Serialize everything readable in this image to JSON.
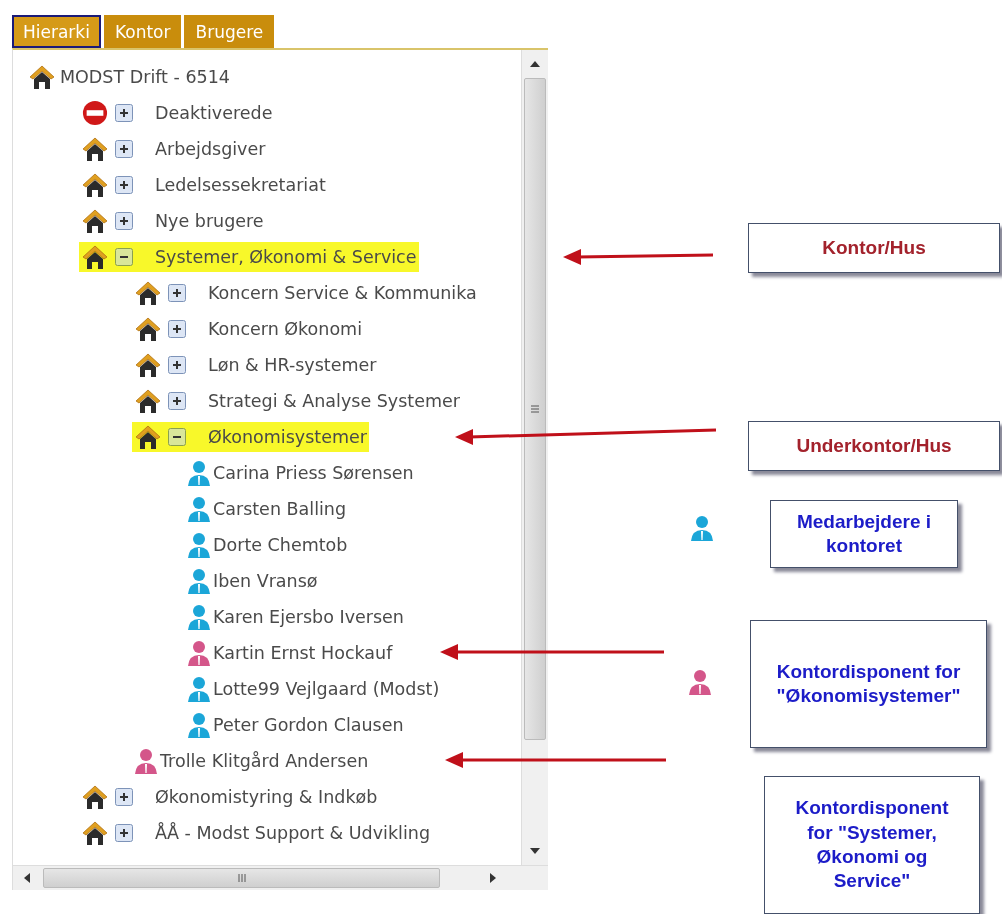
{
  "tabs": [
    {
      "label": "Hierarki",
      "selected": true
    },
    {
      "label": "Kontor",
      "selected": false
    },
    {
      "label": "Brugere",
      "selected": false
    }
  ],
  "tree": {
    "label": "MODST Drift - 6514",
    "kind": "office",
    "highlighted": false,
    "children": [
      {
        "label": "Deaktiverede",
        "kind": "deactivated",
        "expanded": false,
        "highlighted": false
      },
      {
        "label": "Arbejdsgiver",
        "kind": "office",
        "expanded": false,
        "highlighted": false
      },
      {
        "label": "Ledelsessekretariat",
        "kind": "office",
        "expanded": false,
        "highlighted": false
      },
      {
        "label": "Nye brugere",
        "kind": "office",
        "expanded": false,
        "highlighted": false
      },
      {
        "label": "Systemer, Økonomi & Service",
        "kind": "office",
        "expanded": true,
        "highlighted": true,
        "children": [
          {
            "label": "Koncern Service & Kommunika",
            "kind": "office",
            "expanded": false,
            "highlighted": false
          },
          {
            "label": "Koncern Økonomi",
            "kind": "office",
            "expanded": false,
            "highlighted": false
          },
          {
            "label": "Løn & HR-systemer",
            "kind": "office",
            "expanded": false,
            "highlighted": false
          },
          {
            "label": "Strategi & Analyse Systemer",
            "kind": "office",
            "expanded": false,
            "highlighted": false
          },
          {
            "label": "Økonomisystemer",
            "kind": "office",
            "expanded": true,
            "highlighted": true,
            "children": [
              {
                "label": "Carina Priess Sørensen",
                "kind": "person",
                "color": "#1ba6d8"
              },
              {
                "label": "Carsten Balling",
                "kind": "person",
                "color": "#1ba6d8"
              },
              {
                "label": "Dorte Chemtob",
                "kind": "person",
                "color": "#1ba6d8"
              },
              {
                "label": "Iben Vransø",
                "kind": "person",
                "color": "#1ba6d8"
              },
              {
                "label": "Karen Ejersbo Iversen",
                "kind": "person",
                "color": "#1ba6d8"
              },
              {
                "label": "Kartin Ernst Hockauf",
                "kind": "person",
                "color": "#d4568a"
              },
              {
                "label": "Lotte99 Vejlgaard (Modst)",
                "kind": "person",
                "color": "#1ba6d8"
              },
              {
                "label": "Peter Gordon Clausen",
                "kind": "person",
                "color": "#1ba6d8"
              }
            ]
          },
          {
            "label": "Trolle Klitgård Andersen",
            "kind": "person",
            "color": "#d4568a"
          }
        ]
      },
      {
        "label": "Økonomistyring & Indkøb",
        "kind": "office",
        "expanded": false,
        "highlighted": false
      },
      {
        "label": "ÅÅ - Modst Support & Udvikling",
        "kind": "office",
        "expanded": false,
        "highlighted": false
      }
    ]
  },
  "annotations": [
    {
      "text": "Kontor/Hus",
      "color": "#a3222c"
    },
    {
      "text": "Underkontor/Hus",
      "color": "#a3222c"
    },
    {
      "text": "Medarbejdere i kontoret",
      "color": "#1c1cc8",
      "icon": {
        "color": "#1ba6d8"
      }
    },
    {
      "text": "Kontordisponent for \"Økonomisystemer\"",
      "color": "#1c1cc8",
      "icon": {
        "color": "#d4568a"
      }
    },
    {
      "text": "Kontordisponent for \"Systemer, Økonomi og Service\"",
      "color": "#1c1cc8"
    }
  ]
}
